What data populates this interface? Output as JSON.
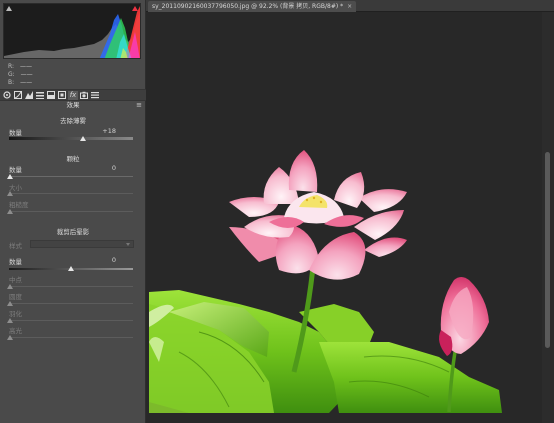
{
  "document": {
    "tab_title": "sy_20110902160037796050.jpg @ 92.2% (背景 拷贝, RGB/8#) *",
    "close_glyph": "×"
  },
  "info": {
    "r_label": "R:",
    "g_label": "G:",
    "b_label": "B:",
    "r_value": "——",
    "g_value": "——",
    "b_value": "——"
  },
  "toolbar": {
    "icons": [
      "camera-basic-icon",
      "tone-curve-icon",
      "detail-icon",
      "hsl-icon",
      "split-toning-icon",
      "lens-icon",
      "fx-icon",
      "camera-calibration-icon",
      "presets-icon"
    ],
    "fx_label": "fx"
  },
  "panel": {
    "title": "效果",
    "menu_glyph": "≡"
  },
  "dehaze": {
    "title": "去除薄雾",
    "amount_label": "数量",
    "amount_value": "+18",
    "amount": 18
  },
  "grain": {
    "title": "颗粒",
    "amount_label": "数量",
    "amount_value": "0",
    "size_label": "大小",
    "roughness_label": "粗糙度"
  },
  "vignette": {
    "title": "裁剪后晕影",
    "style_label": "样式",
    "amount_label": "数量",
    "amount_value": "0",
    "midpoint_label": "中点",
    "roundness_label": "圆度",
    "feather_label": "羽化",
    "highlights_label": "高光"
  },
  "colors": {
    "panel_bg": "#4a4a4a",
    "canvas_bg": "#282828",
    "petal_pink": "#ee6f98",
    "leaf_green": "#74c81e"
  }
}
